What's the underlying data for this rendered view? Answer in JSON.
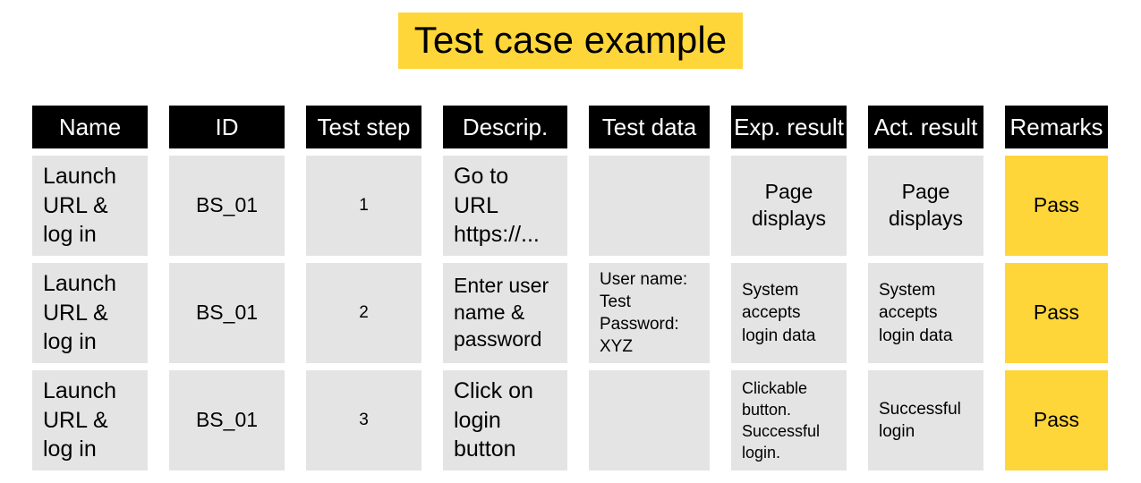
{
  "title": {
    "text": "Test case example",
    "highlight_color": "#FFD639"
  },
  "colors": {
    "header_bg": "#000000",
    "header_text": "#FFFFFF",
    "cell_bg": "#E4E4E4",
    "pass_bg": "#FFD639",
    "page_bg": "#FFFFFF",
    "text": "#000000"
  },
  "table": {
    "headers": [
      "Name",
      "ID",
      "Test step",
      "Descrip.",
      "Test data",
      "Exp. result",
      "Act. result",
      "Remarks"
    ],
    "rows": [
      {
        "name": "Launch\nURL &\nlog in",
        "id": "BS_01",
        "test_step": "1",
        "description": "Go to\nURL\nhttps://...",
        "test_data": "",
        "expected_result": "Page\ndisplays",
        "actual_result": "Page\ndisplays",
        "remarks": "Pass"
      },
      {
        "name": "Launch\nURL &\nlog in",
        "id": "BS_01",
        "test_step": "2",
        "description": "Enter user\nname &\npassword",
        "test_data": "User name:\nTest\nPassword:\nXYZ",
        "expected_result": "System\naccepts\nlogin data",
        "actual_result": "System\naccepts\nlogin data",
        "remarks": "Pass"
      },
      {
        "name": "Launch\nURL &\nlog in",
        "id": "BS_01",
        "test_step": "3",
        "description": "Click on\nlogin\nbutton",
        "test_data": "",
        "expected_result": "Clickable\nbutton.\nSuccessful\nlogin.",
        "actual_result": "Successful\nlogin",
        "remarks": "Pass"
      }
    ]
  }
}
